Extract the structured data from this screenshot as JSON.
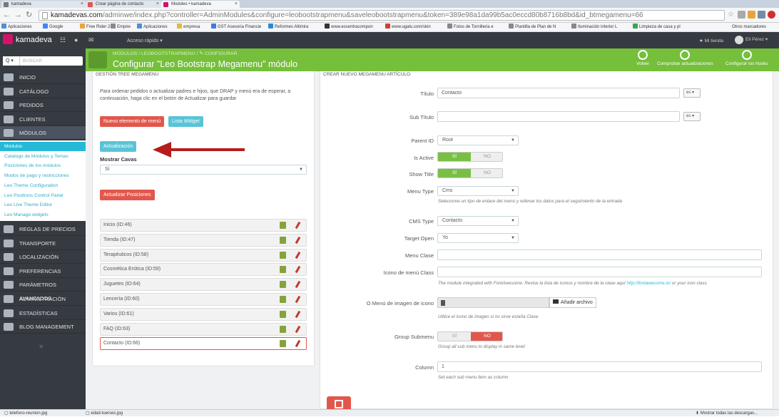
{
  "browser": {
    "tabs": [
      {
        "label": "kamadeva",
        "fav": "#7a7a7a"
      },
      {
        "label": "Crear página de contacto",
        "fav": "#e2574c"
      },
      {
        "label": "Modules • kamadeva",
        "fav": "#d5126b"
      }
    ],
    "url_host": "kamadevas.com",
    "url_path": "/adminwe/index.php?controller=AdminModules&configure=leobootstrapmenu&saveleobootstrapmenu&token=389e98a1da99b5ac0eccd80b8716b8bd&id_btmegamenu=66",
    "bookmarks": [
      "Aplicaciones",
      "Google",
      "Free Rider 2",
      "Empire",
      "Aplicaciones",
      "empresa",
      "GST Asesoria Financie",
      "Reformes Altimira",
      "www.essentracompon",
      "www.ugatu.com/skin",
      "Fotos de Tornilleria e",
      "Plantilla de Plan de N",
      "Iluminación interior L",
      "Limpieza de casa y pl"
    ],
    "bookmarks_more": "Otros marcadores",
    "bookmark_colors": [
      "#4a90d9",
      "#4285f4",
      "#e9a53a",
      "#888",
      "#4a90d9",
      "#e5b73b",
      "#3b7ddd",
      "#2a8ad8",
      "#333",
      "#d04030",
      "#888",
      "#888",
      "#888",
      "#34a853"
    ]
  },
  "admin": {
    "brand": "kamadeva",
    "quick_access": "Acceso rápido ▾",
    "shop": "★ Mi tienda",
    "user": "Eli Pérez ▾",
    "search_btn": "Q ▾",
    "search_placeholder": "Buscar"
  },
  "sidebar": {
    "items": [
      "Inicio",
      "Catálogo",
      "Pedidos",
      "Clientes",
      "Módulos"
    ],
    "items_after": [
      "Reglas de precios",
      "Transporte",
      "Localización",
      "Preferencias",
      "Parámetros avanzados",
      "Administración",
      "Estadísticas",
      "Blog Management"
    ],
    "submenu": [
      "Módulos",
      "Catalogo de Módulos y Temas",
      "Posiciones de los módulos",
      "Modos de pago y restricciones",
      "Leo Theme Configuration",
      "Leo Positions Control Panel",
      "Leo Live Theme Editor",
      "Leo Manage widgets"
    ],
    "footer": "≡"
  },
  "toolbar": {
    "breadcrumb": "MÓDULOS  /  LEOBOOTSTRAPMENU  /  ✎ CONFIGURAR",
    "title": "Configurar \"Leo Bootstrap Megamenu\" módulo",
    "buttons": [
      "Volver",
      "Comprobar actualizaciones",
      "Configurar los hooks"
    ]
  },
  "left_panel": {
    "heading": "GESTIÓN TREE MEGAMENU",
    "description": "Para ordenar pedidos o actualizar padres e hijos, que DRAP y menú era de esperar, a continuación, haga clic en el botón de Actualizar para guardar",
    "new_item": "Nuevo elemento de menú",
    "widget_list": "Lista Widget",
    "update": "Actualización",
    "show_caves_label": "Mostrar Cavas",
    "show_caves_value": "Sí",
    "update_positions": "Actualizar Posiciones",
    "menu_items": [
      "Inicio (ID:46)",
      "Tienda (ID:47)",
      "Terapéuticos (ID:58)",
      "Cosmética Erótica (ID:59)",
      "Juguetes (ID:64)",
      "Lencería (ID:60)",
      "Varios (ID:61)",
      "FAQ (ID:63)",
      "Contacto (ID:66)"
    ],
    "selected_index": 8
  },
  "right_panel": {
    "heading": "CREAR NUEVO MEGAMENU ARTÍCULO.",
    "lang": "es ▾",
    "fields": {
      "title_label": "Título",
      "title_value": "Contacto",
      "subtitle_label": "Sub Título",
      "subtitle_value": "",
      "parent_label": "Parent ID",
      "parent_value": "Root",
      "active_label": "Is Active",
      "show_title_label": "Show Title",
      "menu_type_label": "Menu Type",
      "menu_type_value": "Cms",
      "menu_type_help": "Seleccione un tipo de enlace del menú y rellenar los datos para el seguimiento de la entrada",
      "cms_type_label": "CMS Type",
      "cms_type_value": "Contacto",
      "target_label": "Target Open",
      "target_value": "Yo",
      "class_label": "Menu Clase",
      "class_value": "",
      "icon_class_label": "Icono de menú Class",
      "icon_class_value": "",
      "icon_class_help": "The module integrated with FontAwesome. Revise la lista de iconos y nombre de la clase aquí ",
      "icon_class_link": "http://fontawesome.io/",
      "icon_class_help2": " or your icon class",
      "image_label": "O Menú de imagen de icono",
      "add_file": "Añadir archivo",
      "image_help": "Utilice el icono de imagen si no sirve estaña Clase",
      "group_label": "Group Submenu",
      "group_help": "Group all sub menu to display in same level",
      "column_label": "Column",
      "column_value": "1",
      "column_help": "Set each sub menu item as column"
    },
    "yes": "SÍ",
    "no": "NO"
  },
  "downloads": {
    "files": [
      "telefono-reunion.jpg",
      "edad-tuerses.jpg"
    ],
    "show_all": "Mostrar todas las descargas..."
  },
  "colors": {
    "accent": "#25b9d7",
    "toolbar": "#75bf3b",
    "danger": "#e2574c",
    "sidebar": "#363a41"
  }
}
